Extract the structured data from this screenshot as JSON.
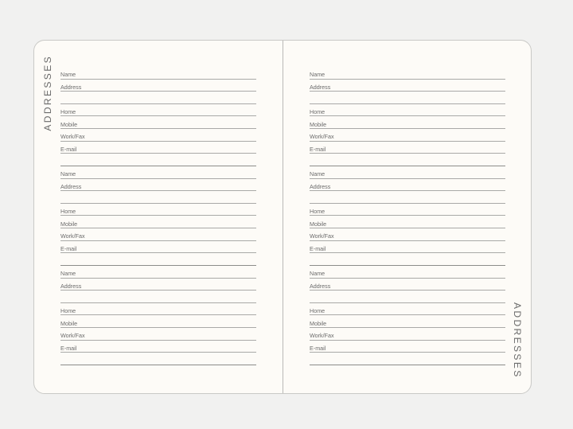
{
  "tab_label": "ADDRESSES",
  "entry_fields": [
    "Name",
    "Address",
    "",
    "Home",
    "Mobile",
    "Work/Fax",
    "E-mail",
    ""
  ],
  "pages": [
    {
      "entries": 3
    },
    {
      "entries": 3
    }
  ]
}
